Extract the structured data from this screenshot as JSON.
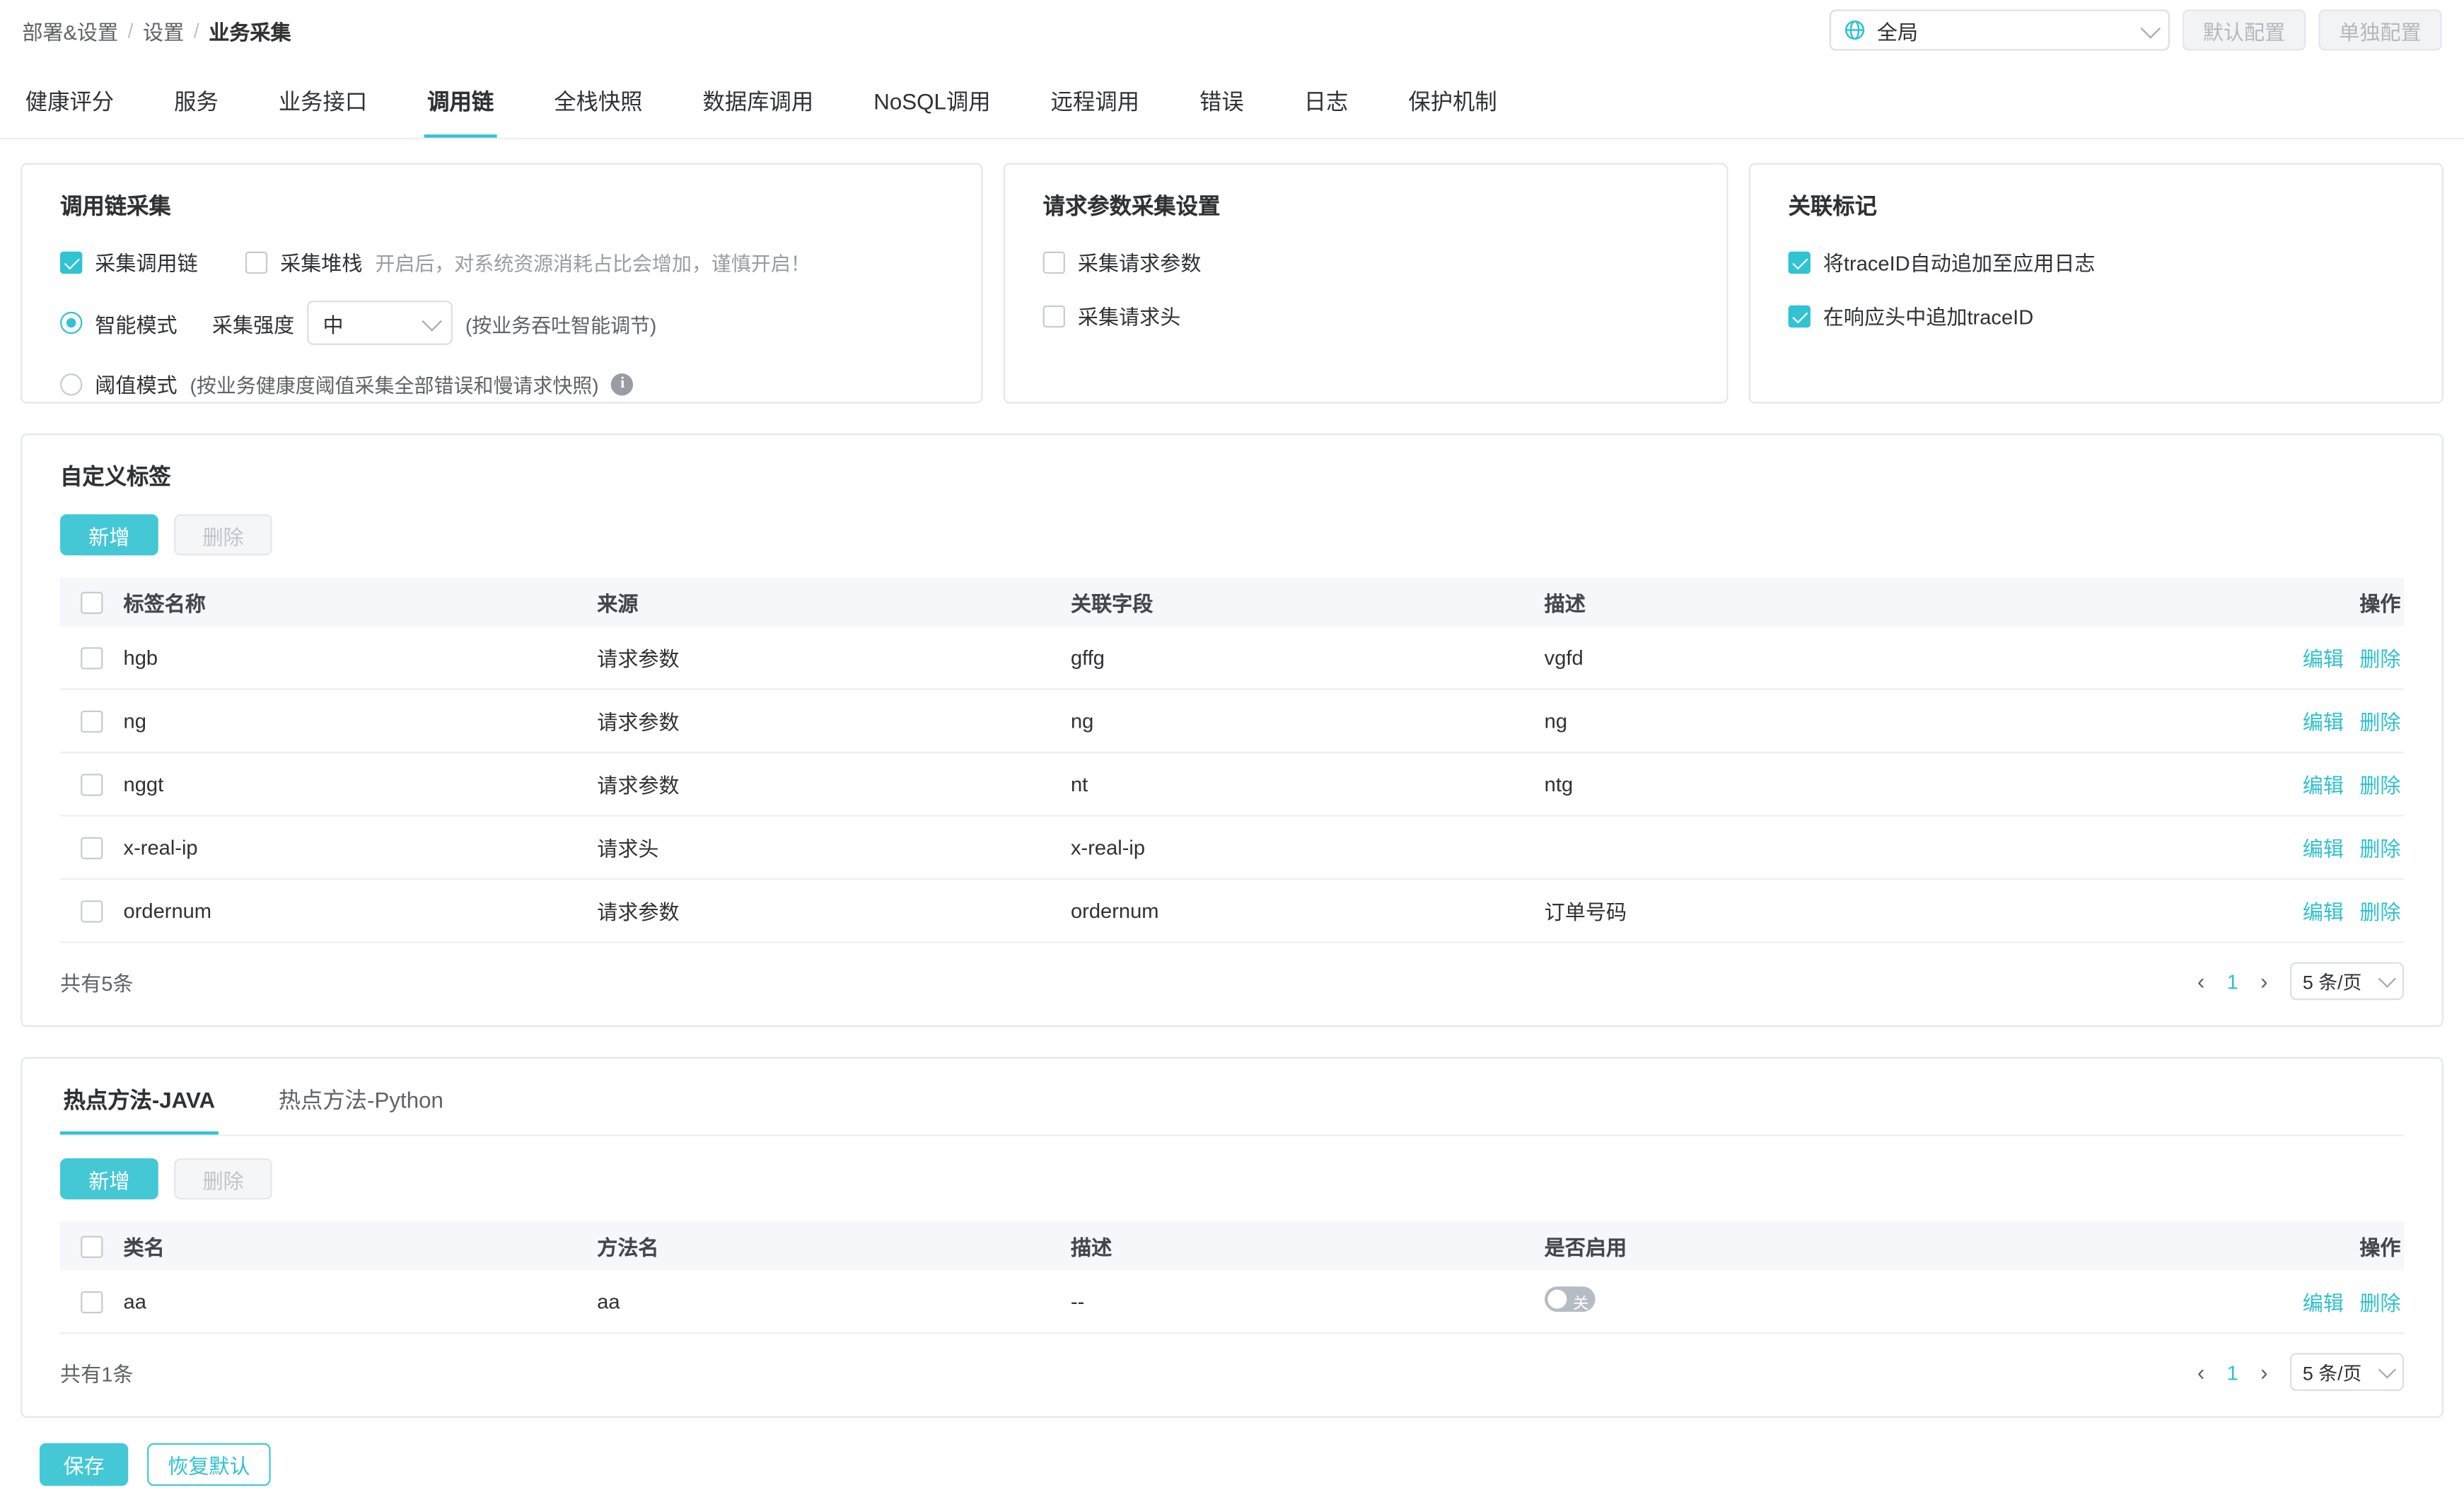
{
  "colors": {
    "accent": "#30c3d2",
    "link": "#2fc1cf",
    "table_header_bg": "#f5f7fa"
  },
  "breadcrumb": {
    "items": [
      "部署&设置",
      "设置",
      "业务采集"
    ],
    "separator": "/"
  },
  "topbar": {
    "scope_select": {
      "value": "全局",
      "icon": "globe-icon"
    },
    "default_config_btn": "默认配置",
    "separate_config_btn": "单独配置"
  },
  "tabs": {
    "items": [
      {
        "label": "健康评分"
      },
      {
        "label": "服务"
      },
      {
        "label": "业务接口"
      },
      {
        "label": "调用链",
        "active": true
      },
      {
        "label": "全栈快照"
      },
      {
        "label": "数据库调用"
      },
      {
        "label": "NoSQL调用"
      },
      {
        "label": "远程调用"
      },
      {
        "label": "错误"
      },
      {
        "label": "日志"
      },
      {
        "label": "保护机制"
      }
    ]
  },
  "trace_card": {
    "title": "调用链采集",
    "collect_trace": {
      "label": "采集调用链",
      "checked": true
    },
    "collect_stack": {
      "label": "采集堆栈",
      "checked": false,
      "hint": "开启后，对系统资源消耗占比会增加，谨慎开启！"
    },
    "smart_mode": {
      "label": "智能模式",
      "selected": true,
      "strength_label": "采集强度",
      "strength_value": "中",
      "hint": "(按业务吞吐智能调节)"
    },
    "threshold_mode": {
      "label": "阈值模式",
      "selected": false,
      "hint": "(按业务健康度阈值采集全部错误和慢请求快照)",
      "info_icon": "i"
    }
  },
  "request_card": {
    "title": "请求参数采集设置",
    "collect_params": {
      "label": "采集请求参数",
      "checked": false
    },
    "collect_headers": {
      "label": "采集请求头",
      "checked": false
    }
  },
  "mark_card": {
    "title": "关联标记",
    "append_log": {
      "label": "将traceID自动追加至应用日志",
      "checked": true
    },
    "append_header": {
      "label": "在响应头中追加traceID",
      "checked": true
    }
  },
  "custom_tags": {
    "title": "自定义标签",
    "add_btn": "新增",
    "delete_btn": "删除",
    "headers": [
      "标签名称",
      "来源",
      "关联字段",
      "描述",
      "操作"
    ],
    "rows": [
      {
        "name": "hgb",
        "source": "请求参数",
        "field": "gffg",
        "desc": "vgfd"
      },
      {
        "name": "ng",
        "source": "请求参数",
        "field": "ng",
        "desc": "ng"
      },
      {
        "name": "nggt",
        "source": "请求参数",
        "field": "nt",
        "desc": "ntg"
      },
      {
        "name": "x-real-ip",
        "source": "请求头",
        "field": "x-real-ip",
        "desc": ""
      },
      {
        "name": "ordernum",
        "source": "请求参数",
        "field": "ordernum",
        "desc": "订单号码"
      }
    ],
    "edit_label": "编辑",
    "del_label": "删除",
    "total": "共有5条",
    "page": "1",
    "prev_icon": "‹",
    "next_icon": "›",
    "page_size": "5 条/页"
  },
  "hot_methods": {
    "tabs": [
      {
        "label": "热点方法-JAVA",
        "active": true
      },
      {
        "label": "热点方法-Python"
      }
    ],
    "add_btn": "新增",
    "delete_btn": "删除",
    "headers": [
      "类名",
      "方法名",
      "描述",
      "是否启用",
      "操作"
    ],
    "rows": [
      {
        "class_name": "aa",
        "method_name": "aa",
        "desc": "--",
        "enabled": false,
        "toggle_label": "关"
      }
    ],
    "edit_label": "编辑",
    "del_label": "删除",
    "total": "共有1条",
    "page": "1",
    "prev_icon": "‹",
    "next_icon": "›",
    "page_size": "5 条/页"
  },
  "footer": {
    "save_btn": "保存",
    "reset_btn": "恢复默认"
  }
}
